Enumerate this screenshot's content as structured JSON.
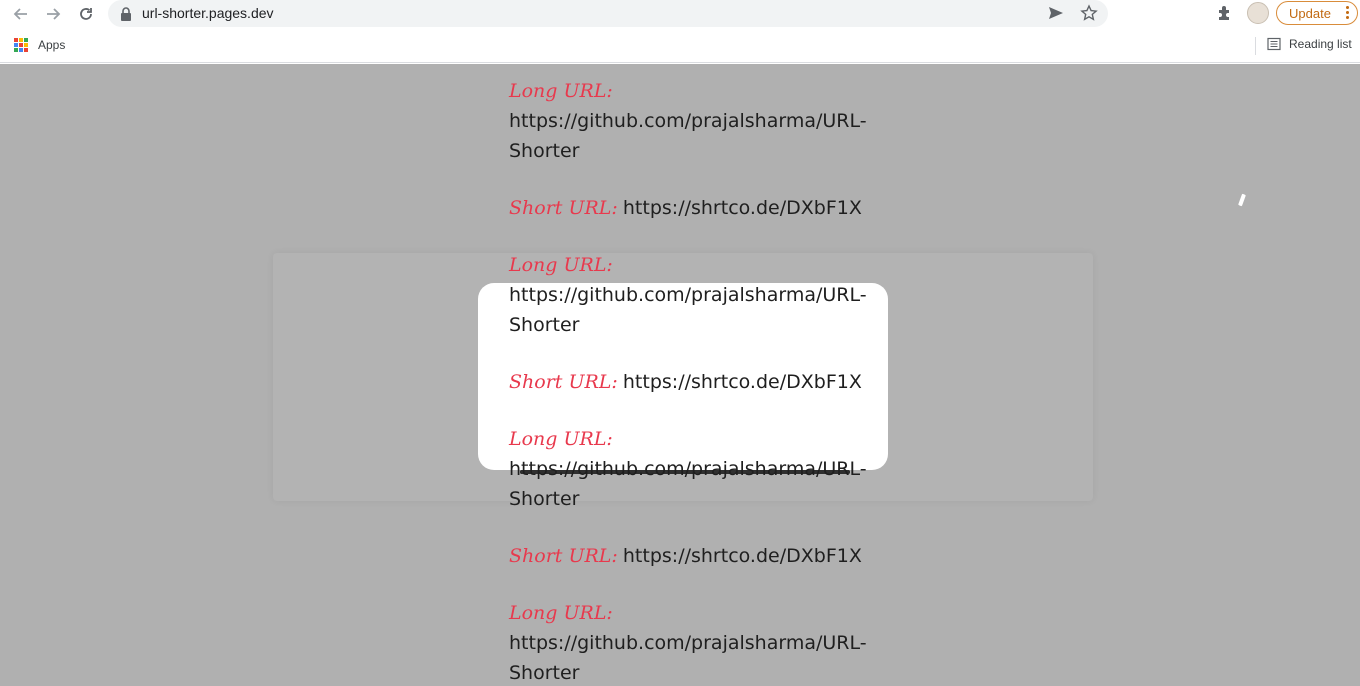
{
  "browser": {
    "url": "url-shorter.pages.dev",
    "update_label": "Update",
    "bookmarks": {
      "apps_label": "Apps",
      "reading_list_label": "Reading list"
    },
    "icons": [
      "back-icon",
      "forward-icon",
      "reload-icon",
      "lock-icon",
      "send-icon",
      "star-icon",
      "extensions-icon",
      "avatar",
      "more-icon",
      "apps-grid-icon",
      "reading-list-icon"
    ]
  },
  "page": {
    "entries": [
      {
        "long_label": "Long URL:",
        "long_url": "https://github.com/prajalsharma/URL-Shorter",
        "short_label": "Short URL:",
        "short_url": "https://shrtco.de/DXbF1X"
      },
      {
        "long_label": "Long URL:",
        "long_url": "https://github.com/prajalsharma/URL-Shorter",
        "short_label": "Short URL:",
        "short_url": "https://shrtco.de/DXbF1X"
      },
      {
        "long_label": "Long URL:",
        "long_url": "https://github.com/prajalsharma/URL-Shorter",
        "short_label": "Short URL:",
        "short_url": "https://shrtco.de/DXbF1X"
      },
      {
        "long_label": "Long URL:",
        "long_url": "https://github.com/prajalsharma/URL-Shorter"
      }
    ],
    "colors": {
      "label": "#e8394d",
      "overlay": "#b0b0b0"
    }
  }
}
